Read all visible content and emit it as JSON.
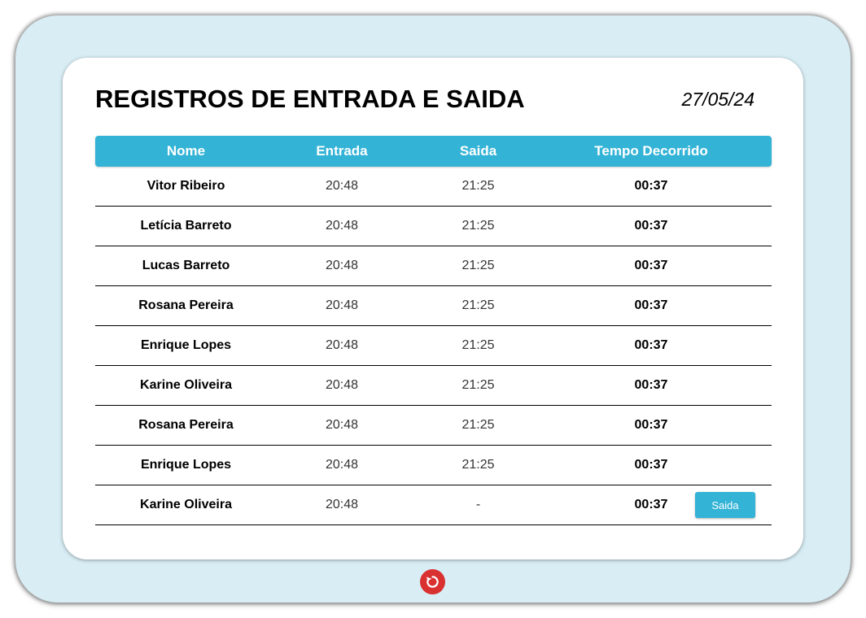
{
  "header": {
    "title": "REGISTROS DE ENTRADA E SAIDA",
    "date": "27/05/24"
  },
  "table": {
    "columns": [
      "Nome",
      "Entrada",
      "Saida",
      "Tempo Decorrido"
    ],
    "rows": [
      {
        "nome": "Vitor Ribeiro",
        "entrada": "20:48",
        "saida": "21:25",
        "tempo": "00:37"
      },
      {
        "nome": "Letícia Barreto",
        "entrada": "20:48",
        "saida": "21:25",
        "tempo": "00:37"
      },
      {
        "nome": "Lucas Barreto",
        "entrada": "20:48",
        "saida": "21:25",
        "tempo": "00:37"
      },
      {
        "nome": "Rosana Pereira",
        "entrada": "20:48",
        "saida": "21:25",
        "tempo": "00:37"
      },
      {
        "nome": "Enrique Lopes",
        "entrada": "20:48",
        "saida": "21:25",
        "tempo": "00:37"
      },
      {
        "nome": "Karine Oliveira",
        "entrada": "20:48",
        "saida": "21:25",
        "tempo": "00:37"
      },
      {
        "nome": "Rosana Pereira",
        "entrada": "20:48",
        "saida": "21:25",
        "tempo": "00:37"
      },
      {
        "nome": "Enrique Lopes",
        "entrada": "20:48",
        "saida": "21:25",
        "tempo": "00:37"
      },
      {
        "nome": "Karine Oliveira",
        "entrada": "20:48",
        "saida": "-",
        "tempo": "00:37",
        "action": "Saida"
      }
    ]
  },
  "footer": {
    "refresh_icon": "refresh-icon"
  },
  "colors": {
    "accent": "#33b3d6",
    "background": "#d8edf4",
    "refresh": "#d93030"
  }
}
